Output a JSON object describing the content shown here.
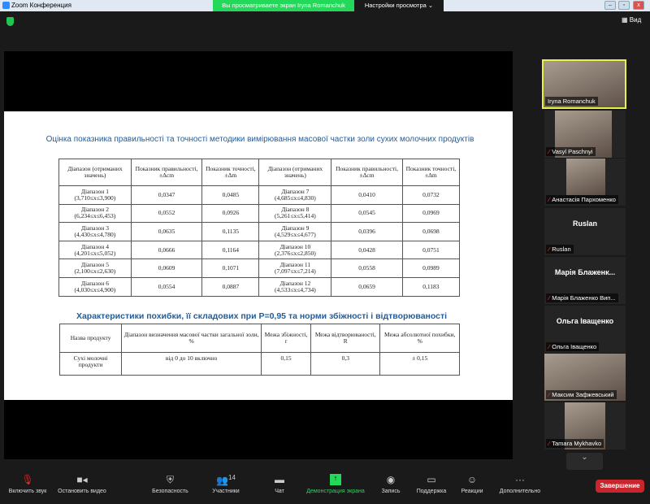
{
  "window": {
    "title": "Zoom Конференция",
    "banner": "Вы просматриваете экран Iryna Romanchuk",
    "view_settings": "Настройки просмотра ⌄",
    "view_label": "Вид"
  },
  "slide": {
    "title1": "Оцінка показника правильності та точності методики вимірювання масової частки золи сухих молочних продуктів",
    "table1": {
      "headers": [
        "Діапазон (отриманих значень)",
        "Показник правильності, ±Δcm",
        "Показник точності, ±Δm",
        "Діапазон (отриманих значень)",
        "Показник правильності, ±Δcm",
        "Показник точності, ±Δm"
      ],
      "rows": [
        [
          "Діапазон 1 (3,710≤x≤3,900)",
          "0,0347",
          "0,0485",
          "Діапазон 7 (4,685≤x≤4,830)",
          "0,0410",
          "0,0732"
        ],
        [
          "Діапазон 2 (6,234≤x≤6,453)",
          "0,0552",
          "0,0926",
          "Діапазон 8 (5,261≤x≤5,414)",
          "0,0545",
          "0,0969"
        ],
        [
          "Діапазон 3 (4,430≤x≤4,780)",
          "0,0635",
          "0,1135",
          "Діапазон 9 (4,529≤x≤4,677)",
          "0,0396",
          "0,0698"
        ],
        [
          "Діапазон 4 (4,201≤x≤5,052)",
          "0,0666",
          "0,1164",
          "Діапазон 10 (2,376≤x≤2,850)",
          "0,0428",
          "0,0751"
        ],
        [
          "Діапазон 5 (2,100≤x≤2,630)",
          "0,0609",
          "0,1071",
          "Діапазон 11 (7,097≤x≤7,214)",
          "0,0558",
          "0,0989"
        ],
        [
          "Діапазон 6 (4,030≤x≤4,900)",
          "0,0554",
          "0,0887",
          "Діапазон 12 (4,533≤x≤4,734)",
          "0,0659",
          "0,1183"
        ]
      ]
    },
    "title2": "Характеристики похибки, її складових при P=0,95 та норми збіжності і відтворюваності",
    "table2": {
      "headers": [
        "Назва продукту",
        "Діапазон визначення масової частки загальної золи, %",
        "Межа збіжності, r",
        "Межа відтворюваності, R",
        "Межа абсолютної похибки, %"
      ],
      "rows": [
        [
          "Сухі молочні продукти",
          "від 0 до 10 включно",
          "0,15",
          "0,3",
          "±  0,15"
        ]
      ]
    }
  },
  "participants": [
    {
      "name": "Iryna Romanchuk",
      "video": true,
      "active": true,
      "muted": false
    },
    {
      "name": "Vasyl Paschnyi",
      "video": true,
      "muted": true
    },
    {
      "name": "Анастасія Пархоменко",
      "video": true,
      "muted": true
    },
    {
      "name": "Ruslan",
      "display": "Ruslan",
      "video": false,
      "muted": true
    },
    {
      "name": "Марія Блаженко Вип...",
      "display": "Марія  Блаженк...",
      "video": false,
      "muted": true
    },
    {
      "name": "Ольга Іващенко",
      "display": "Ольга Іващенко",
      "video": false,
      "muted": true
    },
    {
      "name": "Максим Зафжевський",
      "video": true,
      "muted": true
    },
    {
      "name": "Tamara Mykhavko",
      "video": true,
      "muted": true
    }
  ],
  "toolbar": {
    "unmute": "Включить звук",
    "stop_video": "Остановить видео",
    "security": "Безопасность",
    "participants": "Участники",
    "participants_count": "14",
    "chat": "Чат",
    "share": "Демонстрация экрана",
    "record": "Запись",
    "support": "Поддержка",
    "reactions": "Реакции",
    "more": "Дополнительно",
    "end": "Завершение"
  },
  "colors": {
    "accent": "#23d959",
    "end": "#c9252c",
    "slide_title": "#1f5d9e"
  }
}
